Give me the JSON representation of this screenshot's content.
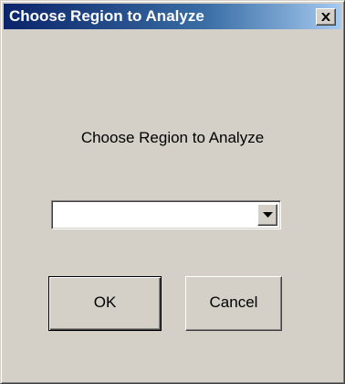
{
  "window": {
    "title": "Choose Region to Analyze",
    "title_gradient": [
      "#0a246a",
      "#a6caf0"
    ],
    "face_color": "#d4d0c8"
  },
  "dialog": {
    "prompt": "Choose Region to Analyze",
    "region_select": {
      "selected_value": "",
      "icon": "chevron-down-icon"
    },
    "ok_label": "OK",
    "cancel_label": "Cancel"
  },
  "icons": {
    "close": "close-icon"
  }
}
